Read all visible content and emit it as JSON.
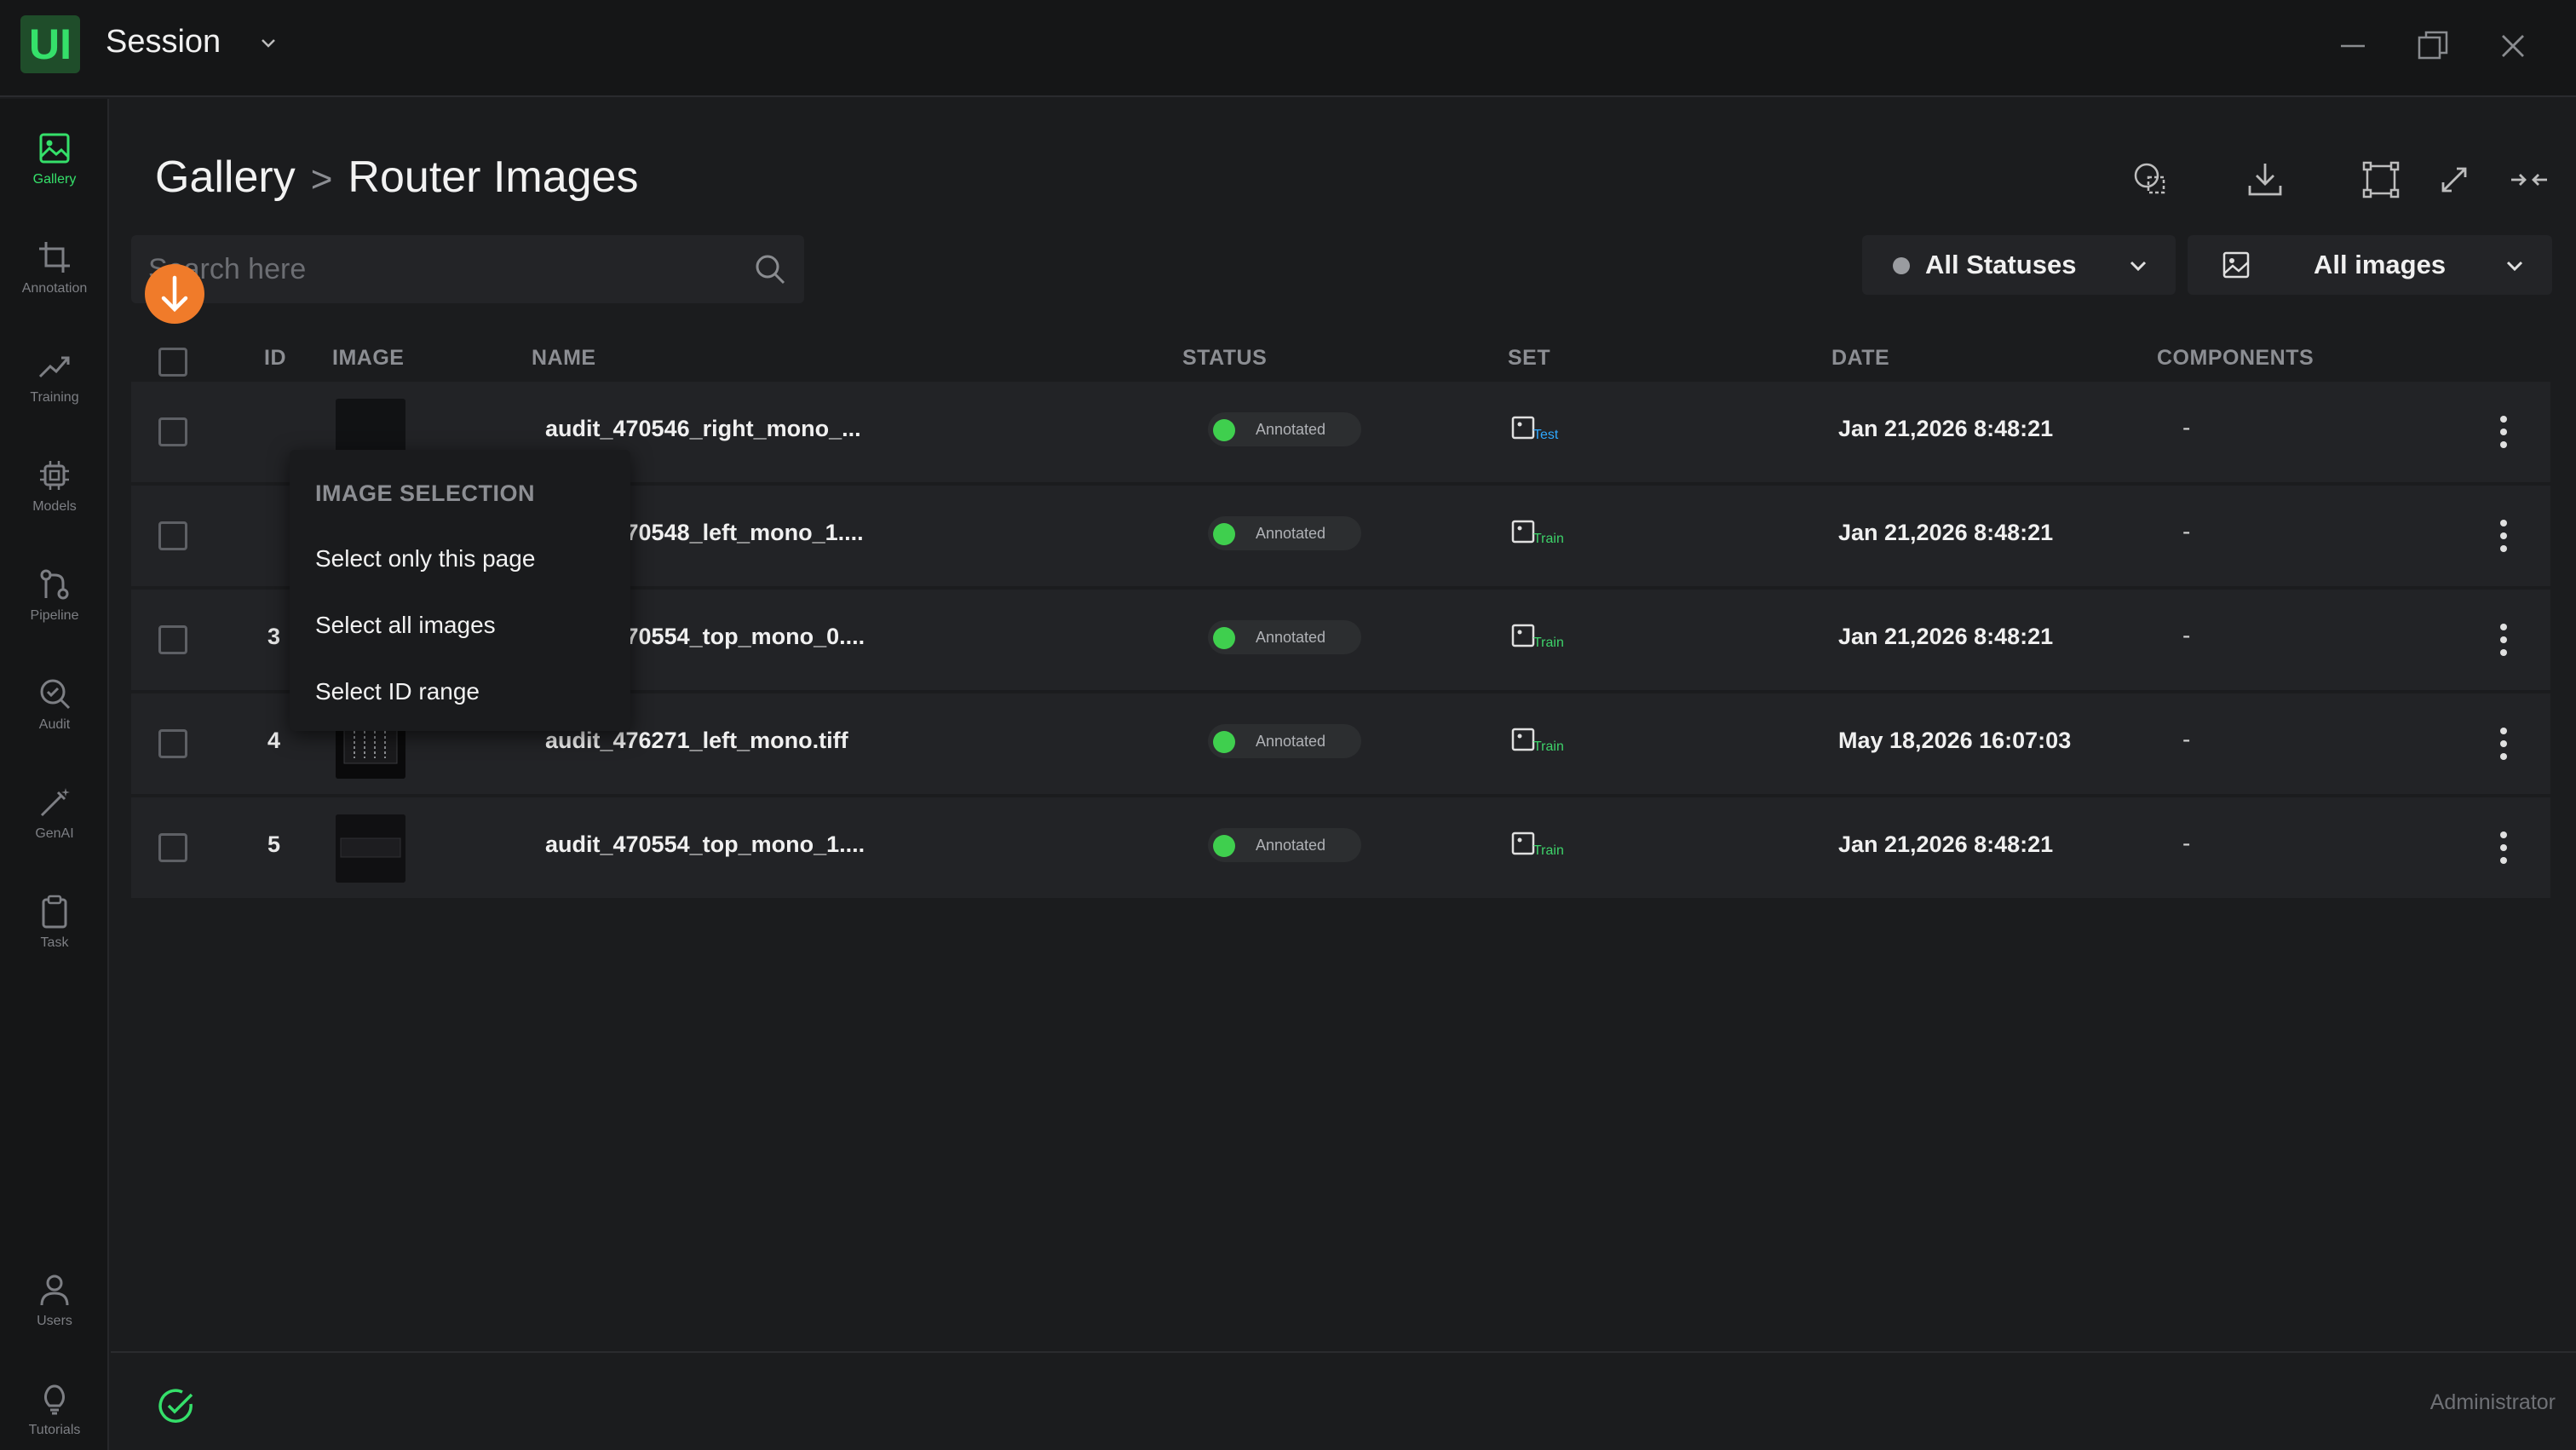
{
  "app": {
    "logo_text": "UI",
    "session_title": "Session"
  },
  "sidebar": {
    "items": [
      {
        "label": "Gallery",
        "icon": "gallery-icon",
        "active": true
      },
      {
        "label": "Annotation",
        "icon": "crop-icon"
      },
      {
        "label": "Training",
        "icon": "trend-icon"
      },
      {
        "label": "Models",
        "icon": "chip-icon"
      },
      {
        "label": "Pipeline",
        "icon": "pipeline-icon"
      },
      {
        "label": "Audit",
        "icon": "audit-icon"
      },
      {
        "label": "GenAI",
        "icon": "magic-wand-icon"
      },
      {
        "label": "Task",
        "icon": "clipboard-icon"
      }
    ],
    "bottom_items": [
      {
        "label": "Users",
        "icon": "user-icon"
      },
      {
        "label": "Tutorials",
        "icon": "lightbulb-icon"
      }
    ]
  },
  "header": {
    "breadcrumb_root": "Gallery",
    "breadcrumb_sep": ">",
    "breadcrumb_current": "Router Images"
  },
  "search": {
    "placeholder": "Search here"
  },
  "filters": {
    "status_label": "All Statuses",
    "images_label": "All images"
  },
  "table": {
    "columns": {
      "id": "ID",
      "image": "IMAGE",
      "name": "NAME",
      "status": "STATUS",
      "set": "SET",
      "date": "DATE",
      "components": "COMPONENTS"
    },
    "rows": [
      {
        "id": "",
        "name": "audit_470546_right_mono_...",
        "status": "Annotated",
        "set": "Test",
        "date": "Jan 21,2026 8:48:21",
        "components": "-"
      },
      {
        "id": "",
        "name": "audit_470548_left_mono_1....",
        "status": "Annotated",
        "set": "Train",
        "date": "Jan 21,2026 8:48:21",
        "components": "-"
      },
      {
        "id": "3",
        "name": "audit_470554_top_mono_0....",
        "status": "Annotated",
        "set": "Train",
        "date": "Jan 21,2026 8:48:21",
        "components": "-"
      },
      {
        "id": "4",
        "name": "audit_476271_left_mono.tiff",
        "status": "Annotated",
        "set": "Train",
        "date": "May 18,2026 16:07:03",
        "components": "-"
      },
      {
        "id": "5",
        "name": "audit_470554_top_mono_1....",
        "status": "Annotated",
        "set": "Train",
        "date": "Jan 21,2026 8:48:21",
        "components": "-"
      }
    ]
  },
  "selection_menu": {
    "header": "IMAGE SELECTION",
    "items": [
      "Select only this page",
      "Select all images",
      "Select ID range"
    ]
  },
  "footer": {
    "role": "Administrator"
  },
  "colors": {
    "accent_green": "#35e06a",
    "status_green": "#3fcf4e",
    "test_blue": "#2ea8ff",
    "badge_orange": "#f07b2a"
  }
}
